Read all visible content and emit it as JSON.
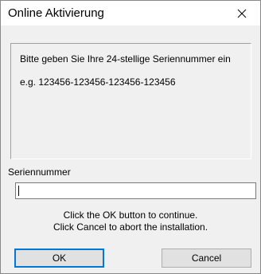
{
  "window": {
    "title": "Online Aktivierung",
    "close_icon": "close-icon"
  },
  "info": {
    "line1": "Bitte geben Sie Ihre 24-stellige Seriennummer ein",
    "line2": "e.g. 123456-123456-123456-123456"
  },
  "serial": {
    "label": "Seriennummer",
    "value": "",
    "placeholder": ""
  },
  "message": {
    "line1": "Click the OK button to continue.",
    "line2": "Click Cancel to abort the installation."
  },
  "buttons": {
    "ok_label": "OK",
    "cancel_label": "Cancel"
  },
  "colors": {
    "dialog_background": "#f0f0f0",
    "titlebar_background": "#ffffff",
    "default_button_border": "#0078d7"
  }
}
